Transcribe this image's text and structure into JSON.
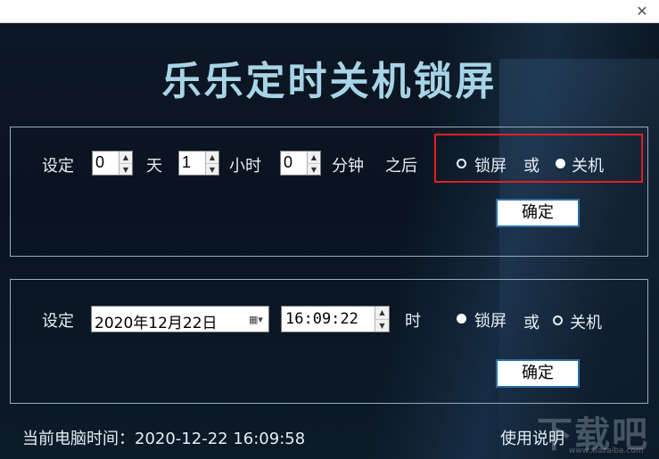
{
  "window": {
    "close_glyph": "✕"
  },
  "app": {
    "title": "乐乐定时关机锁屏"
  },
  "countdown_panel": {
    "set_label": "设定",
    "days_value": "0",
    "days_unit": "天",
    "hours_value": "1",
    "hours_unit": "小时",
    "minutes_value": "0",
    "minutes_unit": "分钟",
    "after_label": "之后",
    "lock_label": "锁屏",
    "or_label": "或",
    "shutdown_label": "关机",
    "selected_action": "shutdown",
    "confirm_label": "确定"
  },
  "schedule_panel": {
    "set_label": "设定",
    "date_value": "2020年12月22日",
    "time_value": "16:09:22",
    "time_unit": "时",
    "lock_label": "锁屏",
    "or_label": "或",
    "shutdown_label": "关机",
    "selected_action": "lock",
    "confirm_label": "确定"
  },
  "footer": {
    "current_time_label": "当前电脑时间：",
    "current_time_value": "2020-12-22 16:09:58",
    "help_label": "使用说明"
  },
  "watermark": {
    "main": "下载吧",
    "sub": "www.xiazaiba.com"
  },
  "colors": {
    "title": "#a7d4e6",
    "highlight_box": "#e02020",
    "button_border": "#2c6fa5"
  }
}
